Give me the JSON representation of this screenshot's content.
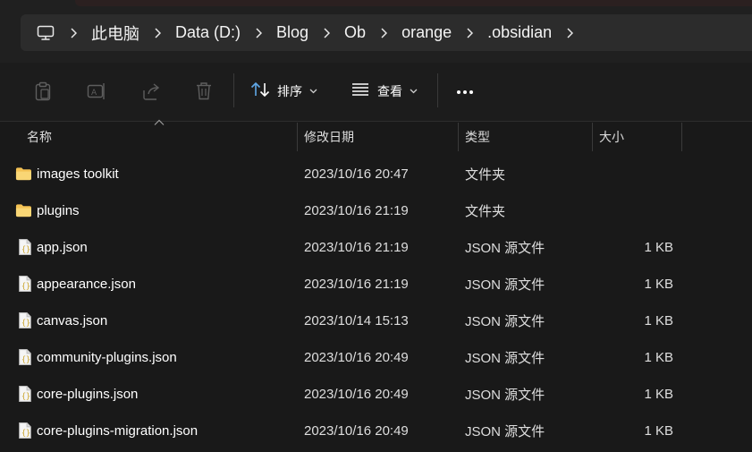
{
  "breadcrumb": {
    "root_icon": "this-pc-icon",
    "items": [
      "此电脑",
      "Data (D:)",
      "Blog",
      "Ob",
      "orange",
      ".obsidian"
    ]
  },
  "toolbar": {
    "icons": [
      "paste-icon",
      "rename-icon",
      "share-icon",
      "delete-icon"
    ],
    "sort_label": "排序",
    "view_label": "查看",
    "more_icon": "more-icon"
  },
  "columns": {
    "name": "名称",
    "modified": "修改日期",
    "type": "类型",
    "size": "大小"
  },
  "files": [
    {
      "icon": "folder-icon",
      "name": "images toolkit",
      "modified": "2023/10/16 20:47",
      "type": "文件夹",
      "size": ""
    },
    {
      "icon": "folder-icon",
      "name": "plugins",
      "modified": "2023/10/16 21:19",
      "type": "文件夹",
      "size": ""
    },
    {
      "icon": "json-file-icon",
      "name": "app.json",
      "modified": "2023/10/16 21:19",
      "type": "JSON 源文件",
      "size": "1 KB"
    },
    {
      "icon": "json-file-icon",
      "name": "appearance.json",
      "modified": "2023/10/16 21:19",
      "type": "JSON 源文件",
      "size": "1 KB"
    },
    {
      "icon": "json-file-icon",
      "name": "canvas.json",
      "modified": "2023/10/14 15:13",
      "type": "JSON 源文件",
      "size": "1 KB"
    },
    {
      "icon": "json-file-icon",
      "name": "community-plugins.json",
      "modified": "2023/10/16 20:49",
      "type": "JSON 源文件",
      "size": "1 KB"
    },
    {
      "icon": "json-file-icon",
      "name": "core-plugins.json",
      "modified": "2023/10/16 20:49",
      "type": "JSON 源文件",
      "size": "1 KB"
    },
    {
      "icon": "json-file-icon",
      "name": "core-plugins-migration.json",
      "modified": "2023/10/16 20:49",
      "type": "JSON 源文件",
      "size": "1 KB"
    }
  ],
  "colors": {
    "background": "#191919",
    "address_bar": "#2c2c2c",
    "folder": "#f4c254",
    "accent_blue": "#60a8e8"
  }
}
